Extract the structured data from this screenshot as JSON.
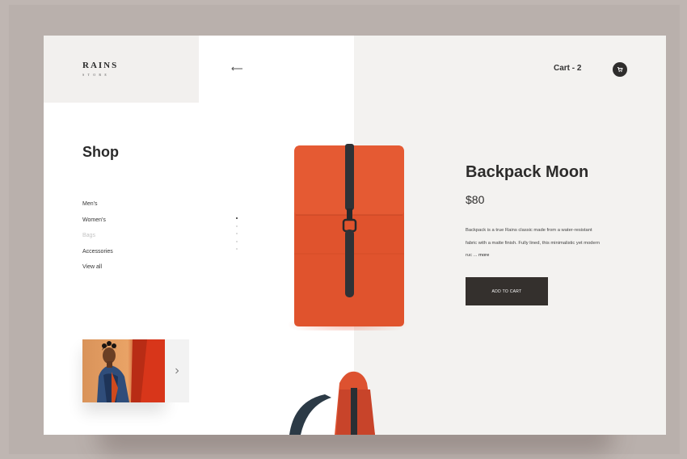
{
  "brand": {
    "name": "RAINS",
    "tagline": "STORE"
  },
  "header": {
    "back_icon": "arrow-left-icon",
    "cart_label": "Cart - 2",
    "cart_icon": "cart-icon"
  },
  "sidebar": {
    "title": "Shop",
    "categories": [
      {
        "label": "Men's",
        "muted": false
      },
      {
        "label": "Women's",
        "muted": false
      },
      {
        "label": "Bags",
        "muted": true
      },
      {
        "label": "Accessories",
        "muted": false
      },
      {
        "label": "View all",
        "muted": false
      }
    ],
    "active_dot": 1,
    "dot_count": 5,
    "thumbnail_next_icon": "chevron-right-icon"
  },
  "product": {
    "name": "Backpack Moon",
    "price": "$80",
    "description": "Backpack is a true Rains classic made from a water-resistant fabric with a matte finish. Fully lined, this minimalistic yet modern ruc ...",
    "more_label": "more",
    "add_to_cart_label": "ADD TO CART"
  },
  "colors": {
    "background": "#bfb6b2",
    "panel": "#f3f2f0",
    "bag_orange": "#e2552e",
    "strap": "#2f3236",
    "button": "#34302d"
  }
}
